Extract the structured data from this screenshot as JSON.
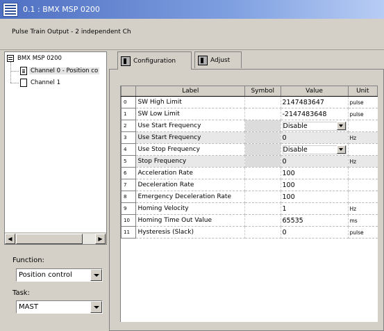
{
  "window": {
    "title": "0.1 : BMX MSP 0200"
  },
  "module_description": "Pulse Train Output - 2 independent Ch",
  "tree": {
    "root": "BMX MSP 0200",
    "channels": [
      "Channel 0 - Position co",
      "Channel 1"
    ]
  },
  "function": {
    "label": "Function:",
    "value": "Position control"
  },
  "task": {
    "label": "Task:",
    "value": "MAST"
  },
  "tabs": [
    "Configuration",
    "Adjust"
  ],
  "table": {
    "headers": [
      "Label",
      "Symbol",
      "Value",
      "Unit"
    ],
    "rows": [
      {
        "num": "0",
        "label": "SW High Limit",
        "value": "2147483647",
        "unit": "pulse"
      },
      {
        "num": "1",
        "label": "SW Low Limit",
        "value": "-2147483648",
        "unit": "pulse"
      },
      {
        "num": "2",
        "label": "Use Start Frequency",
        "value": "Disable",
        "unit": ""
      },
      {
        "num": "3",
        "label": "Use Start Frequency",
        "value": "0",
        "unit": "Hz"
      },
      {
        "num": "4",
        "label": "Use Stop Frequency",
        "value": "Disable",
        "unit": ""
      },
      {
        "num": "5",
        "label": "Stop Frequency",
        "value": "0",
        "unit": "Hz"
      },
      {
        "num": "6",
        "label": "Acceleration Rate",
        "value": "100",
        "unit": ""
      },
      {
        "num": "7",
        "label": "Deceleration Rate",
        "value": "100",
        "unit": ""
      },
      {
        "num": "8",
        "label": "Emergency Deceleration Rate",
        "value": "100",
        "unit": ""
      },
      {
        "num": "9",
        "label": "Homing Velocity",
        "value": "1",
        "unit": "Hz"
      },
      {
        "num": "10",
        "label": "Homing Time Out Value",
        "value": "65535",
        "unit": "ms"
      },
      {
        "num": "11",
        "label": "Hysteresis (Slack)",
        "value": "0",
        "unit": "pulse"
      }
    ]
  }
}
